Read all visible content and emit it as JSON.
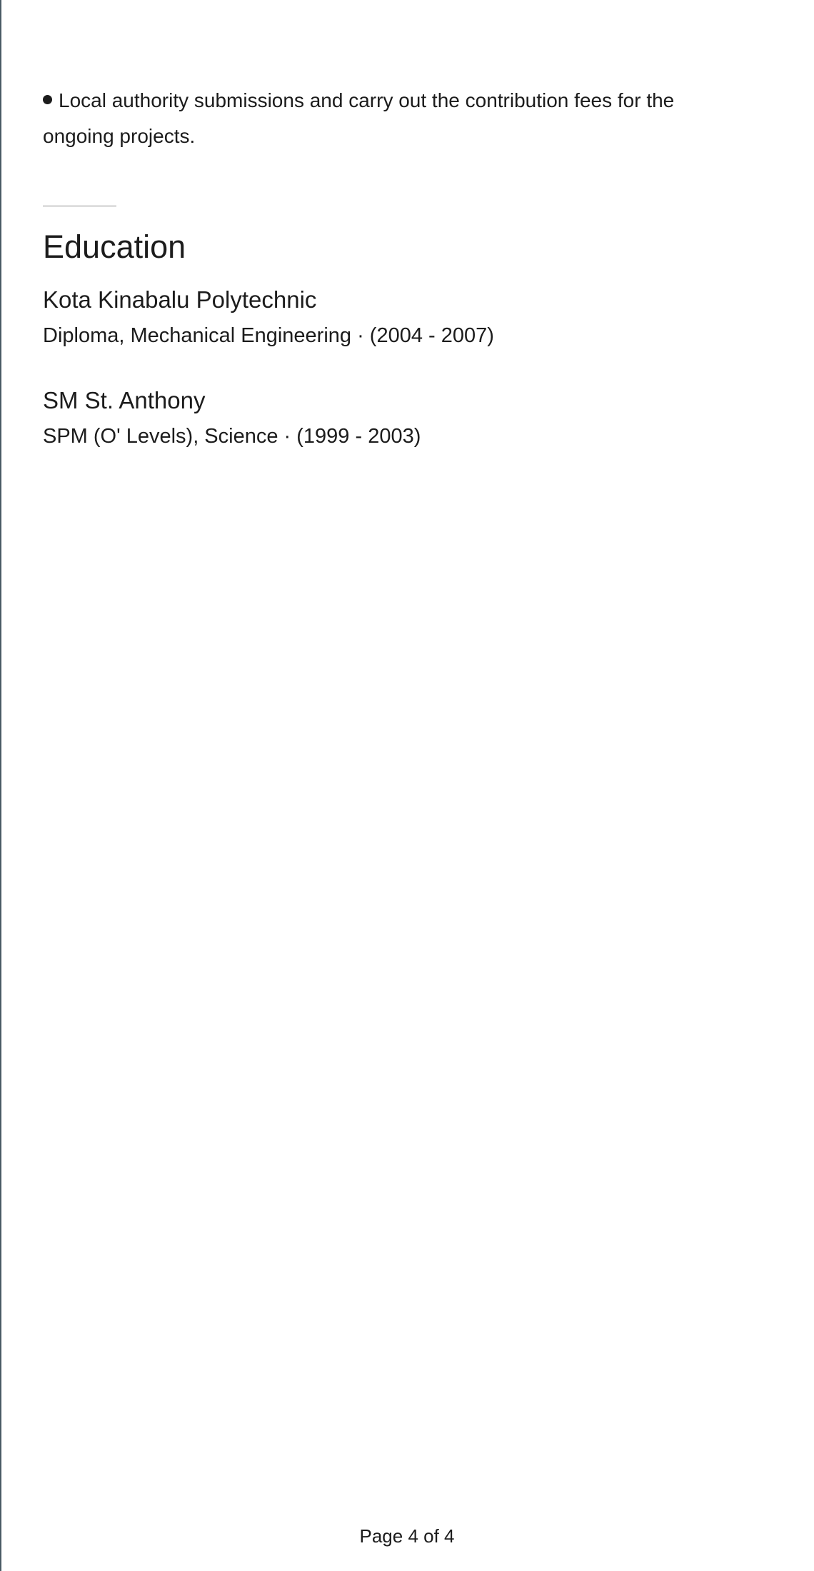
{
  "experience_tail": {
    "bullet_text": "Local authority submissions and carry out the contribution fees for the ongoing projects."
  },
  "education": {
    "section_title": "Education",
    "entries": [
      {
        "school": "Kota Kinabalu Polytechnic",
        "degree": "Diploma, Mechanical Engineering · (2004 - 2007)"
      },
      {
        "school": "SM St. Anthony",
        "degree": "SPM (O' Levels), Science · (1999 - 2003)"
      }
    ]
  },
  "footer": {
    "page_label": "Page 4 of 4"
  }
}
